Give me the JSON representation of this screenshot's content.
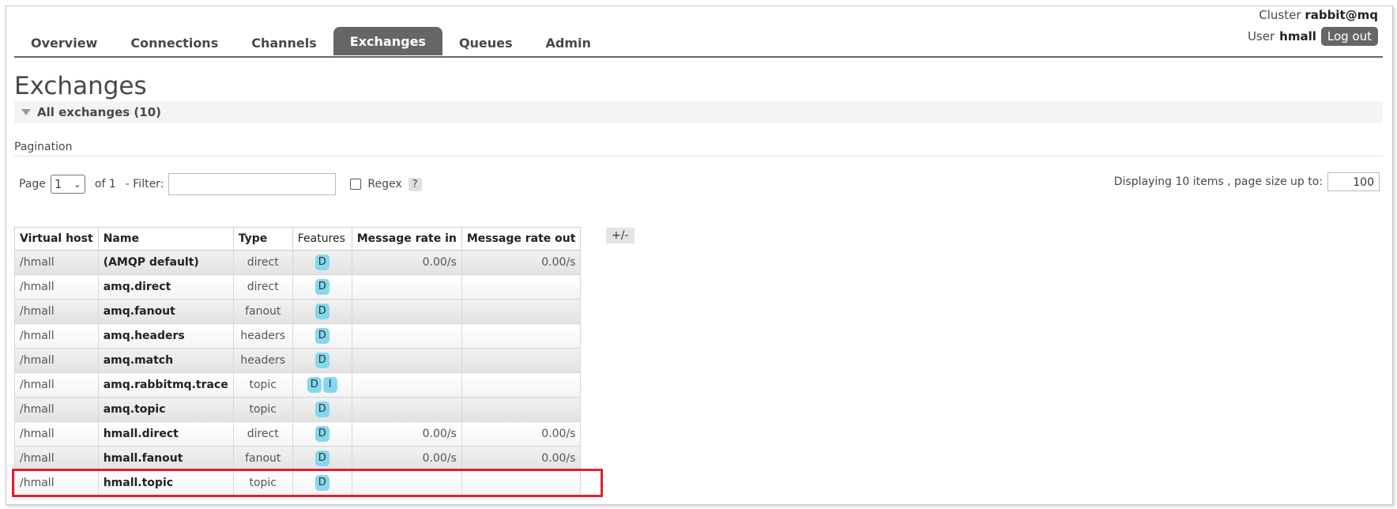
{
  "header": {
    "cluster_label": "Cluster",
    "cluster_name": "rabbit@mq",
    "user_label": "User",
    "user_name": "hmall",
    "logout_label": "Log out"
  },
  "tabs": [
    {
      "label": "Overview"
    },
    {
      "label": "Connections"
    },
    {
      "label": "Channels"
    },
    {
      "label": "Exchanges",
      "active": true
    },
    {
      "label": "Queues"
    },
    {
      "label": "Admin"
    }
  ],
  "page_title": "Exchanges",
  "section_title": "All exchanges (10)",
  "pagination": {
    "label": "Pagination",
    "page_label": "Page",
    "page_value": "1",
    "of_label": "of 1",
    "filter_label": "- Filter:",
    "filter_value": "",
    "regex_label": "Regex",
    "help_label": "?",
    "display_text": "Displaying 10 items , page size up to:",
    "page_size": "100"
  },
  "table": {
    "columns": [
      "Virtual host",
      "Name",
      "Type",
      "Features",
      "Message rate in",
      "Message rate out"
    ],
    "toggle_label": "+/-",
    "rows": [
      {
        "vhost": "/hmall",
        "name": "(AMQP default)",
        "type": "direct",
        "features": [
          "D"
        ],
        "rate_in": "0.00/s",
        "rate_out": "0.00/s"
      },
      {
        "vhost": "/hmall",
        "name": "amq.direct",
        "type": "direct",
        "features": [
          "D"
        ],
        "rate_in": "",
        "rate_out": ""
      },
      {
        "vhost": "/hmall",
        "name": "amq.fanout",
        "type": "fanout",
        "features": [
          "D"
        ],
        "rate_in": "",
        "rate_out": ""
      },
      {
        "vhost": "/hmall",
        "name": "amq.headers",
        "type": "headers",
        "features": [
          "D"
        ],
        "rate_in": "",
        "rate_out": ""
      },
      {
        "vhost": "/hmall",
        "name": "amq.match",
        "type": "headers",
        "features": [
          "D"
        ],
        "rate_in": "",
        "rate_out": ""
      },
      {
        "vhost": "/hmall",
        "name": "amq.rabbitmq.trace",
        "type": "topic",
        "features": [
          "D",
          "I"
        ],
        "rate_in": "",
        "rate_out": ""
      },
      {
        "vhost": "/hmall",
        "name": "amq.topic",
        "type": "topic",
        "features": [
          "D"
        ],
        "rate_in": "",
        "rate_out": ""
      },
      {
        "vhost": "/hmall",
        "name": "hmall.direct",
        "type": "direct",
        "features": [
          "D"
        ],
        "rate_in": "0.00/s",
        "rate_out": "0.00/s"
      },
      {
        "vhost": "/hmall",
        "name": "hmall.fanout",
        "type": "fanout",
        "features": [
          "D"
        ],
        "rate_in": "0.00/s",
        "rate_out": "0.00/s"
      },
      {
        "vhost": "/hmall",
        "name": "hmall.topic",
        "type": "topic",
        "features": [
          "D"
        ],
        "rate_in": "",
        "rate_out": "",
        "highlighted": true
      }
    ]
  },
  "colors": {
    "tab_active": "#666666",
    "badge": "#84d8ee",
    "highlight_border": "#e02030"
  }
}
